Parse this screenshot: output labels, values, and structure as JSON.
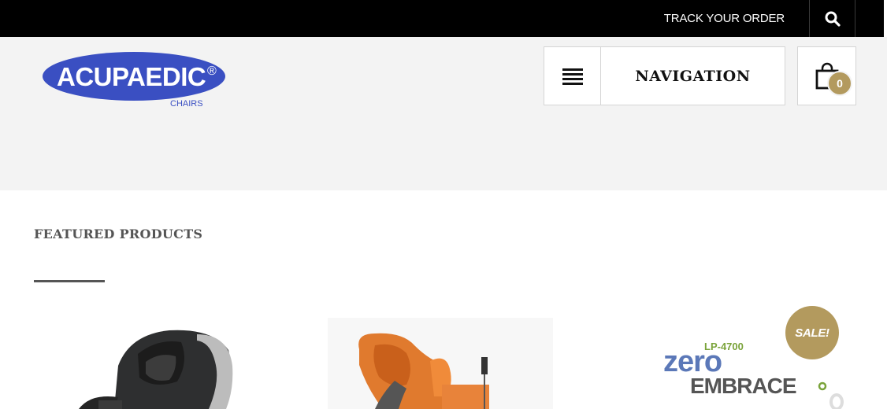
{
  "topbar": {
    "track_label": "TRACK YOUR ORDER",
    "search_icon": "search-icon"
  },
  "header": {
    "logo": {
      "brand": "ACUPAEDIC",
      "registered": "®",
      "sub": "CHAIRS",
      "color": "#3a4fc2"
    },
    "navigation_label": "NAVIGATION",
    "menu_icon": "hamburger-icon",
    "cart_icon": "shopping-bag-icon",
    "cart_count": "0"
  },
  "featured": {
    "title": "FEATURED PRODUCTS",
    "products": [
      {
        "image": "black-massage-chair"
      },
      {
        "image": "orange-massage-chair"
      },
      {
        "image": "zero-embrace-logo",
        "badge": "SALE!",
        "model": "LP-4700",
        "logo_top": "zero",
        "logo_bottom": "EMBRACE"
      }
    ]
  },
  "colors": {
    "accent": "#b39a5e",
    "topbar": "#000000",
    "header_bg": "#f3f3f3"
  }
}
